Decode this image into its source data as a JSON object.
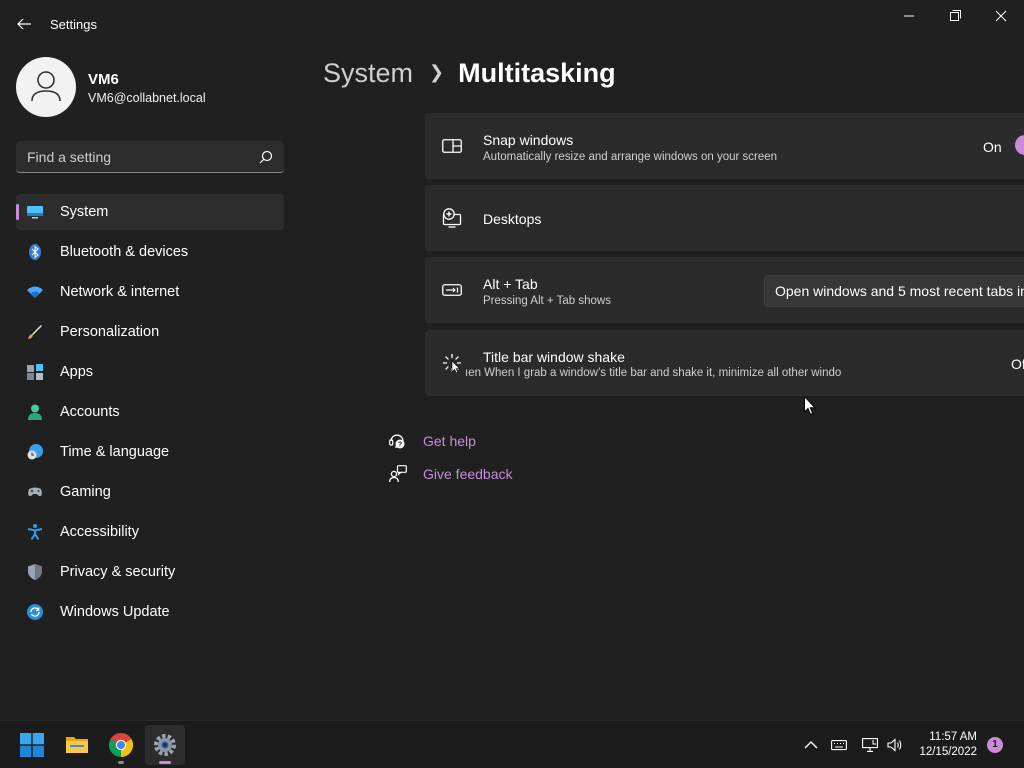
{
  "window": {
    "title": "Settings"
  },
  "profile": {
    "name": "VM6",
    "email": "VM6@collabnet.local"
  },
  "search": {
    "placeholder": "Find a setting"
  },
  "sidebar": {
    "items": [
      {
        "label": "System",
        "icon": "monitor-icon",
        "active": true
      },
      {
        "label": "Bluetooth & devices",
        "icon": "bluetooth-icon"
      },
      {
        "label": "Network & internet",
        "icon": "wifi-icon"
      },
      {
        "label": "Personalization",
        "icon": "brush-icon"
      },
      {
        "label": "Apps",
        "icon": "apps-icon"
      },
      {
        "label": "Accounts",
        "icon": "person-icon"
      },
      {
        "label": "Time & language",
        "icon": "globe-clock-icon"
      },
      {
        "label": "Gaming",
        "icon": "gamepad-icon"
      },
      {
        "label": "Accessibility",
        "icon": "accessibility-icon"
      },
      {
        "label": "Privacy & security",
        "icon": "shield-icon"
      },
      {
        "label": "Windows Update",
        "icon": "update-icon"
      }
    ]
  },
  "breadcrumb": {
    "parent": "System",
    "current": "Multitasking"
  },
  "settings": {
    "snap": {
      "title": "Snap windows",
      "description": "Automatically resize and arrange windows on your screen",
      "state": "On"
    },
    "desktops": {
      "title": "Desktops"
    },
    "alttab": {
      "title": "Alt + Tab",
      "description": "Pressing Alt + Tab shows",
      "value": "Open windows and 5 most recent tabs in"
    },
    "shake": {
      "title": "Title bar window shake",
      "description": "ıen When I grab a window’s title bar and shake it, minimize all other windo",
      "state": "Of"
    }
  },
  "links": {
    "help": "Get help",
    "feedback": "Give feedback"
  },
  "taskbar": {
    "time": "11:57 AM",
    "date": "12/15/2022",
    "notifications": "1"
  },
  "colors": {
    "accent": "#c98cd8",
    "background": "#202020",
    "card": "#2b2b2b"
  }
}
